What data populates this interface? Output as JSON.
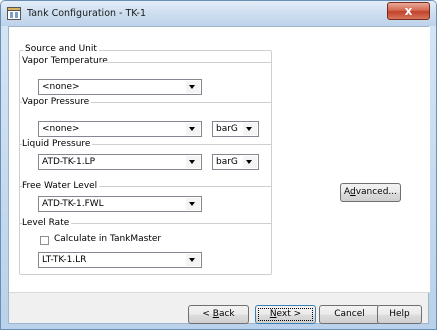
{
  "window": {
    "title": "Tank Configuration - TK-1",
    "close_glyph": "x"
  },
  "groups": {
    "source_unit": {
      "title": "Source and Unit"
    },
    "vapor_temperature": {
      "title": "Vapor Temperature",
      "value": "<none>"
    },
    "vapor_pressure": {
      "title": "Vapor Pressure",
      "value": "<none>",
      "unit": "barG"
    },
    "liquid_pressure": {
      "title": "Liquid Pressure",
      "value": "ATD-TK-1.LP",
      "unit": "barG"
    },
    "free_water_level": {
      "title": "Free Water Level",
      "value": "ATD-TK-1.FWL"
    },
    "level_rate": {
      "title": "Level Rate",
      "checkbox_label": "Calculate in TankMaster",
      "checkbox_checked": false,
      "value": "LT-TK-1.LR"
    }
  },
  "buttons": {
    "advanced": {
      "pre": "A",
      "mn": "d",
      "post": "vanced..."
    },
    "back": {
      "pre": "< ",
      "mn": "B",
      "post": "ack"
    },
    "next": {
      "pre": "",
      "mn": "N",
      "post": "ext >"
    },
    "cancel": "Cancel",
    "help": "Help"
  },
  "icons": {
    "title_icon": "tank-icon",
    "dropdown": "chevron-down-icon"
  },
  "colors": {
    "title_gradient_top": "#e4eef9",
    "close_button": "#c2422a",
    "default_button_border": "#3c7fb1"
  }
}
